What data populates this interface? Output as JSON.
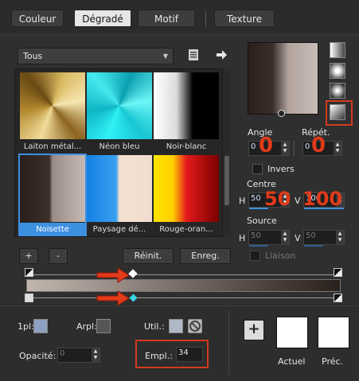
{
  "tabs": [
    "Couleur",
    "Dégradé",
    "Motif",
    "Texture"
  ],
  "category": {
    "selected": "Tous"
  },
  "gradients": [
    {
      "name": "Laiton métal..."
    },
    {
      "name": "Néon bleu"
    },
    {
      "name": "Noir-blanc"
    },
    {
      "name": "Noisette"
    },
    {
      "name": "Paysage dé..."
    },
    {
      "name": "Rouge-oran..."
    }
  ],
  "buttons": {
    "add": "+",
    "remove": "-",
    "reset": "Réinit.",
    "save": "Enreg.",
    "add_big": "+"
  },
  "properties": {
    "angle_label": "Angle",
    "angle_value": "0",
    "repeat_label": "Répét.",
    "repeat_value": "0",
    "invert_label": "Invers",
    "center_label": "Centre",
    "center_h_label": "H",
    "center_h_value": "50",
    "center_v_label": "V",
    "center_v_value": "100",
    "source_label": "Source",
    "source_h_label": "H",
    "source_h_value": "50",
    "source_v_label": "V",
    "source_v_value": "50",
    "link_label": "Liaison"
  },
  "annotations": {
    "angle_big": "0",
    "repeat_big": "0",
    "center_h_big": "50",
    "center_v_big": "100"
  },
  "bottom": {
    "opl_label": "1pl:",
    "arpl_label": "Arpl:",
    "util_label": "Util.:",
    "opacity_label": "Opacité:",
    "opacity_value": "0",
    "empl_label": "Empl.:",
    "empl_value": "34",
    "current_label": "Actuel",
    "previous_label": "Préc."
  },
  "colors": {
    "accent": "#3d8fe0",
    "annotation_red": "#e23a1a"
  }
}
